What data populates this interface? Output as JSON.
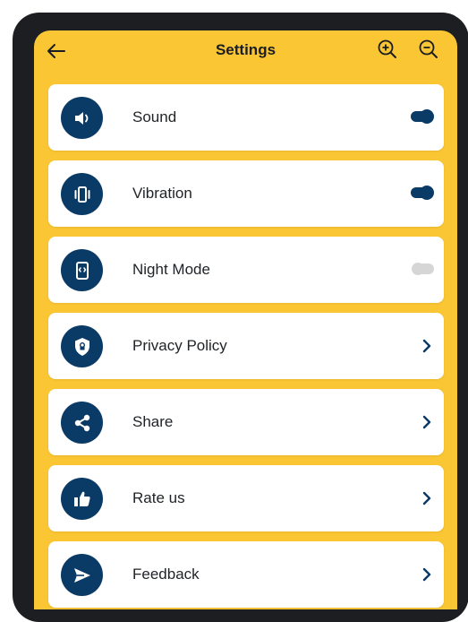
{
  "header": {
    "title": "Settings",
    "back_icon": "arrow-left-icon",
    "zoom_in_icon": "zoom-in-icon",
    "zoom_out_icon": "zoom-out-icon"
  },
  "colors": {
    "background": "#fbc634",
    "accent": "#0a3a66",
    "card": "#ffffff",
    "toggle_off": "#d6d6d6"
  },
  "settings": {
    "items": [
      {
        "label": "Sound",
        "icon": "speaker-icon",
        "control": "toggle",
        "enabled": true
      },
      {
        "label": "Vibration",
        "icon": "vibration-icon",
        "control": "toggle",
        "enabled": true
      },
      {
        "label": "Night Mode",
        "icon": "night-mode-icon",
        "control": "toggle",
        "enabled": false
      },
      {
        "label": "Privacy Policy",
        "icon": "shield-icon",
        "control": "chevron"
      },
      {
        "label": "Share",
        "icon": "share-icon",
        "control": "chevron"
      },
      {
        "label": "Rate us",
        "icon": "thumbs-up-icon",
        "control": "chevron"
      },
      {
        "label": "Feedback",
        "icon": "send-icon",
        "control": "chevron"
      }
    ]
  }
}
